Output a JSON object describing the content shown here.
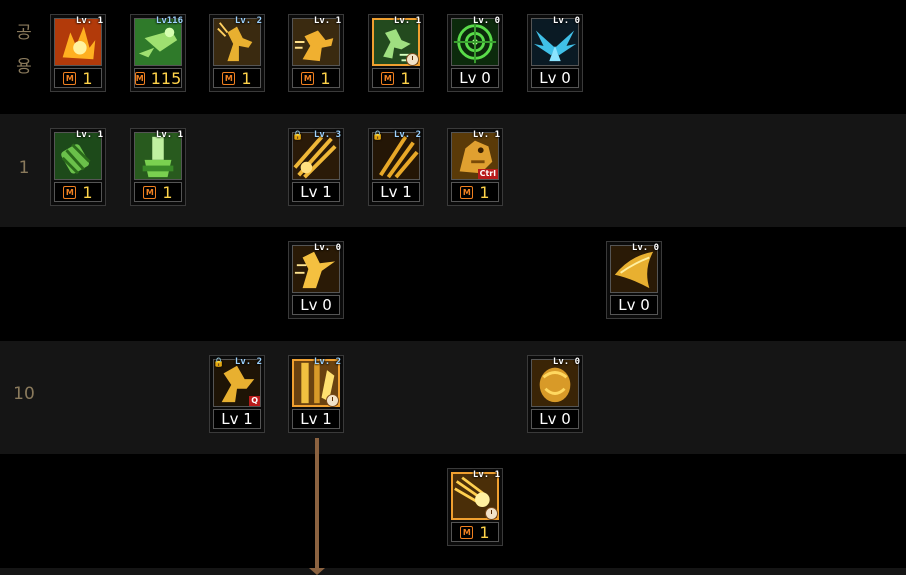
{
  "rows": {
    "common": {
      "label_chars": [
        "공",
        "용"
      ]
    },
    "r1": {
      "label": "1"
    },
    "r10": {
      "label": "10"
    }
  },
  "skills": {
    "c1": {
      "badge": "Lv. 1",
      "level_prefix": "M",
      "level": "1",
      "icon": "fire-burst-icon"
    },
    "c2": {
      "badge": "Lv116",
      "level_prefix": "M",
      "level": "115",
      "icon": "green-dash-icon"
    },
    "c3": {
      "badge": "Lv. 2",
      "level_prefix": "M",
      "level": "1",
      "icon": "gold-kick-icon"
    },
    "c4": {
      "badge": "Lv. 1",
      "level_prefix": "M",
      "level": "1",
      "icon": "gold-sprint-icon"
    },
    "c5": {
      "badge": "Lv. 1",
      "level_prefix": "M",
      "level": "1",
      "icon": "green-jump-icon"
    },
    "c6": {
      "badge": "Lv. 0",
      "level_text": "Lv 0",
      "icon": "target-icon"
    },
    "c7": {
      "badge": "Lv. 0",
      "level_text": "Lv 0",
      "icon": "blue-wings-icon"
    },
    "r1a": {
      "badge": "Lv. 1",
      "level_prefix": "M",
      "level": "1",
      "icon": "green-grenade-icon"
    },
    "r1b": {
      "badge": "Lv. 1",
      "level_prefix": "M",
      "level": "1",
      "icon": "green-potion-icon"
    },
    "r1c": {
      "badge": "Lv. 3",
      "level_text": "Lv 1",
      "icon": "gold-slash-icon"
    },
    "r1d": {
      "badge": "Lv. 2",
      "level_text": "Lv 1",
      "icon": "gold-claw-icon"
    },
    "r1e": {
      "badge": "Lv. 1",
      "level_prefix": "M",
      "level": "1",
      "hotkey": "Ctrl",
      "icon": "gold-beast-icon"
    },
    "r2a": {
      "badge": "Lv. 0",
      "level_text": "Lv 0",
      "icon": "gold-strike-icon"
    },
    "r2b": {
      "badge": "Lv. 0",
      "level_text": "Lv 0",
      "icon": "gold-sweep-icon"
    },
    "r3a": {
      "badge": "Lv. 2",
      "level_text": "Lv 1",
      "hotkey": "Q",
      "icon": "gold-leap-icon"
    },
    "r3b": {
      "badge": "Lv. 2",
      "level_text": "Lv 1",
      "icon": "gold-pillar-icon"
    },
    "r3c": {
      "badge": "Lv. 0",
      "level_text": "Lv 0",
      "icon": "gold-muscle-icon"
    },
    "r4a": {
      "badge": "Lv. 1",
      "level_prefix": "M",
      "level": "1",
      "icon": "gold-burst-icon"
    }
  },
  "colors": {
    "accent": "#f0a030",
    "master": "#f08020",
    "level_num": "#ffd34a",
    "link": "#8b6240",
    "label": "#8a7a5c"
  }
}
